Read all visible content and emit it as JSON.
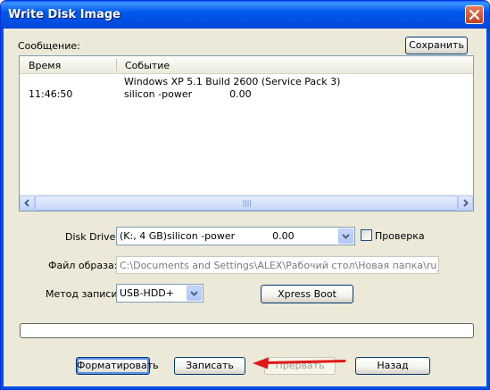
{
  "window": {
    "title": "Write Disk Image"
  },
  "log": {
    "label": "Сообщение:",
    "save_button": "Сохранить",
    "columns": [
      "Время",
      "Событие"
    ],
    "rows": [
      {
        "time": "",
        "event": "Windows XP 5.1 Build 2600 (Service Pack 3)"
      },
      {
        "time": "11:46:50",
        "event": "silicon -power            0.00"
      }
    ]
  },
  "form": {
    "disk_drive_label": "Disk Drive:",
    "disk_drive_value": "(K:, 4 GB)silicon -power            0.00",
    "verify_label": "Проверка",
    "verify_checked": false,
    "image_file_label": "Файл образа:",
    "image_file_value": "C:\\Documents and Settings\\ALEX\\Рабочий стол\\Новая папка\\ru_windo",
    "write_method_label": "Метод записи:",
    "write_method_value": "USB-HDD+",
    "xpress_boot_button": "Xpress Boot"
  },
  "progress": {
    "value": 0
  },
  "buttons": {
    "format": "Форматировать",
    "write": "Записать",
    "abort": "Прервать",
    "back": "Назад"
  },
  "colors": {
    "titlebar": "#0058ee",
    "window_bg": "#ece9d8",
    "annotation_arrow": "#e01818"
  }
}
